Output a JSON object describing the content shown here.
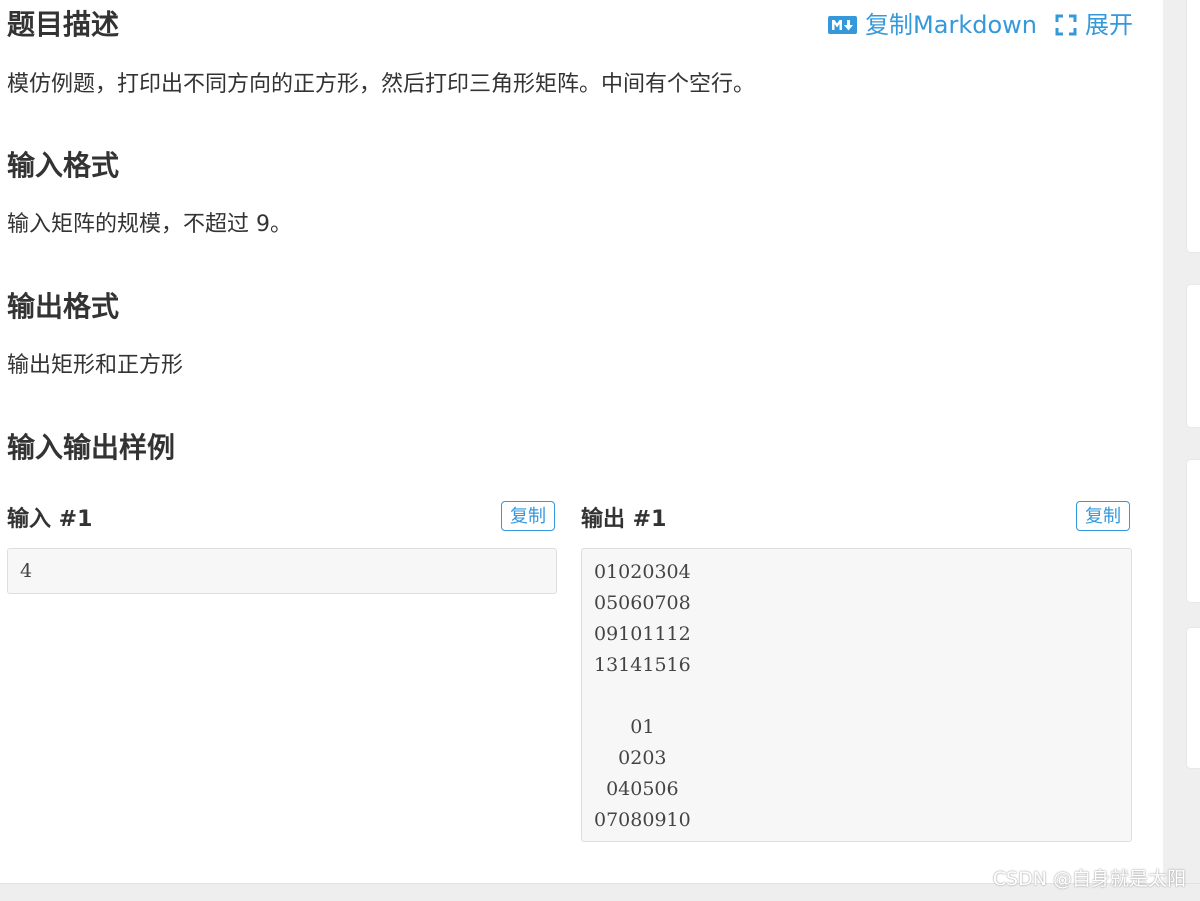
{
  "header": {
    "title": "题目描述",
    "copy_markdown_label": "复制Markdown",
    "expand_label": "展开"
  },
  "description": {
    "text": "模仿例题，打印出不同方向的正方形，然后打印三角形矩阵。中间有个空行。"
  },
  "input_format": {
    "title": "输入格式",
    "text": "输入矩阵的规模，不超过 9。"
  },
  "output_format": {
    "title": "输出格式",
    "text": "输出矩形和正方形"
  },
  "samples": {
    "title": "输入输出样例",
    "input": {
      "label": "输入 #1",
      "copy_label": "复制",
      "content": "4"
    },
    "output": {
      "label": "输出 #1",
      "copy_label": "复制",
      "content": "01020304\n05060708\n09101112\n13141516\n\n      01\n    0203\n  040506\n07080910"
    }
  },
  "watermark": "CSDN @自身就是太阳",
  "colors": {
    "accent": "#3498db",
    "text": "#333333",
    "code_bg": "#f7f7f7"
  },
  "icons": {
    "markdown": "markdown-icon",
    "expand": "expand-icon"
  }
}
